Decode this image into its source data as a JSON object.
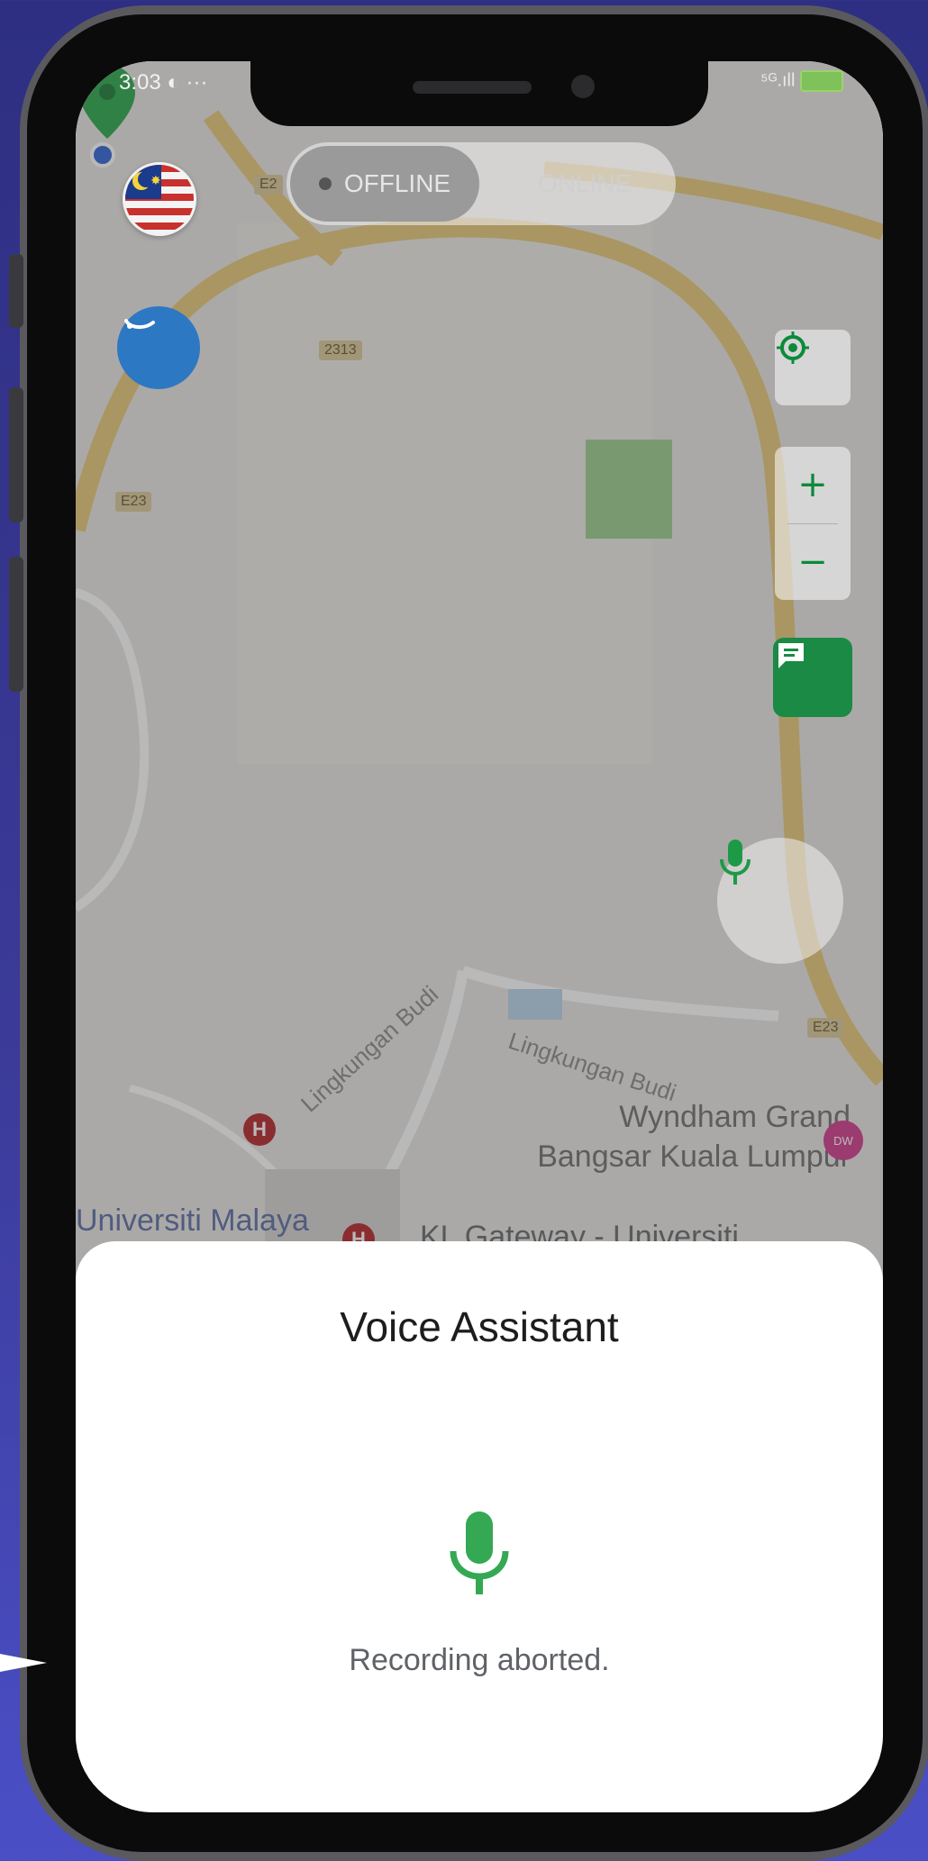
{
  "status_bar": {
    "time": "3:03",
    "left_extra": "◐ ···",
    "right_icons": "⁵ᴳ.ıll"
  },
  "mode_toggle": {
    "offline_label": "OFFLINE",
    "online_label": "ONLINE",
    "selected": "OFFLINE"
  },
  "map": {
    "road_shields": [
      "E2",
      "2313",
      "E23",
      "E23",
      "E23"
    ],
    "road_labels": [
      "Lingkungan Budi",
      "Lingkungan Budi"
    ],
    "places": {
      "wyndham_line1": "Wyndham Grand",
      "wyndham_line2": "Bangsar Kuala Lumpur",
      "university": "Universiti Malaya",
      "kl_gateway": "KL Gateway - Universiti"
    },
    "hospital_glyph": "H",
    "hotel_badge": "DW"
  },
  "controls": {
    "zoom_in_glyph": "+",
    "zoom_out_glyph": "−"
  },
  "voice_sheet": {
    "title": "Voice Assistant",
    "status": "Recording aborted."
  },
  "colors": {
    "accent_green": "#1a8a45",
    "mic_green": "#34a853",
    "chat_blue": "#2d78c3",
    "background_indigo": "#3b3a98"
  }
}
